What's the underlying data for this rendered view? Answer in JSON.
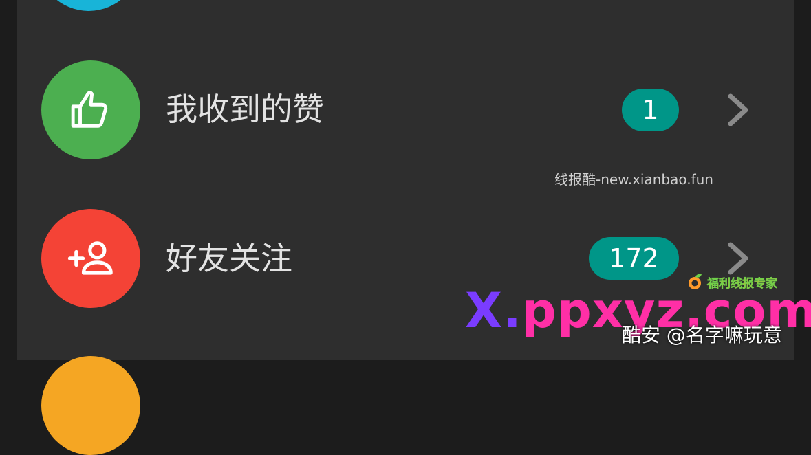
{
  "colors": {
    "panel": "#2e2e2e",
    "top_circle": "#18b4d8",
    "likes_circle": "#4caf50",
    "friends_circle": "#f44336",
    "bottom_circle": "#f5a623",
    "badge": "#009688",
    "chevron": "#8a8a8a"
  },
  "rows": [
    {
      "label": "我收到的赞",
      "count": "1",
      "icon": "thumbs-up-icon"
    },
    {
      "label": "好友关注",
      "count": "172",
      "icon": "add-person-icon"
    }
  ],
  "watermarks": {
    "site_small": "线报酷-new.xianbao.fun",
    "logo_text": "福利线报专家",
    "big_x": "X.",
    "big_rest": "ppxyz.com",
    "author": "酷安 @名字嘛玩意"
  }
}
